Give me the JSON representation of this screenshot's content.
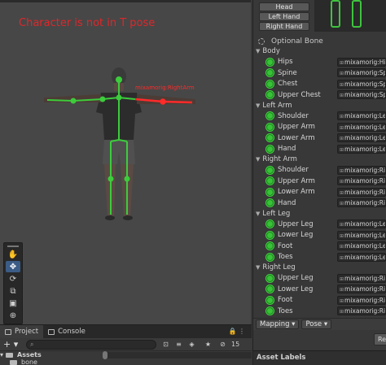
{
  "scene": {
    "overlay_title": "Character is not in T pose",
    "bone_label": "mixamorig:RightArm"
  },
  "tools": [
    "hand-tool",
    "move-tool",
    "rotate-tool",
    "scale-tool",
    "rect-tool",
    "transform-tool"
  ],
  "inspector": {
    "head_buttons": [
      "Head",
      "Left Hand",
      "Right Hand"
    ],
    "optional_bone": "Optional Bone",
    "groups": [
      {
        "label": "Body",
        "bones": [
          {
            "name": "Hips",
            "value": "mixamorig:Hi"
          },
          {
            "name": "Spine",
            "value": "mixamorig:Sp"
          },
          {
            "name": "Chest",
            "value": "mixamorig:Sp"
          },
          {
            "name": "Upper Chest",
            "value": "mixamorig:Sp"
          }
        ]
      },
      {
        "label": "Left Arm",
        "bones": [
          {
            "name": "Shoulder",
            "value": "mixamorig:Le"
          },
          {
            "name": "Upper Arm",
            "value": "mixamorig:Le"
          },
          {
            "name": "Lower Arm",
            "value": "mixamorig:Le"
          },
          {
            "name": "Hand",
            "value": "mixamorig:Le"
          }
        ]
      },
      {
        "label": "Right Arm",
        "bones": [
          {
            "name": "Shoulder",
            "value": "mixamorig:Ri"
          },
          {
            "name": "Upper Arm",
            "value": "mixamorig:Ri"
          },
          {
            "name": "Lower Arm",
            "value": "mixamorig:Ri"
          },
          {
            "name": "Hand",
            "value": "mixamorig:Ri"
          }
        ]
      },
      {
        "label": "Left Leg",
        "bones": [
          {
            "name": "Upper Leg",
            "value": "mixamorig:Le"
          },
          {
            "name": "Lower Leg",
            "value": "mixamorig:Le"
          },
          {
            "name": "Foot",
            "value": "mixamorig:Le"
          },
          {
            "name": "Toes",
            "value": "mixamorig:Le"
          }
        ]
      },
      {
        "label": "Right Leg",
        "bones": [
          {
            "name": "Upper Leg",
            "value": "mixamorig:Ri"
          },
          {
            "name": "Lower Leg",
            "value": "mixamorig:Ri"
          },
          {
            "name": "Foot",
            "value": "mixamorig:Ri"
          },
          {
            "name": "Toes",
            "value": "mixamorig:Ri"
          }
        ]
      }
    ],
    "mapping_label": "Mapping",
    "pose_label": "Pose",
    "reset_label": "Re",
    "asset_labels": "Asset Labels"
  },
  "project": {
    "tab_project": "Project",
    "tab_console": "Console",
    "add_label": "+",
    "search_glyph": "⌕",
    "hidden_count": "15",
    "rows": [
      "Assets",
      "bone"
    ]
  },
  "colors": {
    "title_red": "#e0262a",
    "bone_green": "#38c238",
    "selection_blue": "#3b5c86"
  }
}
